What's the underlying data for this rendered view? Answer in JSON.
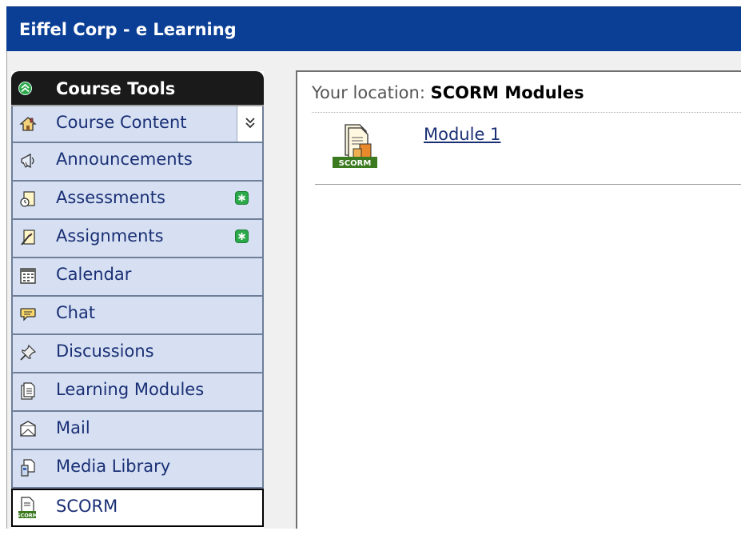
{
  "app": {
    "title": "Eiffel Corp - e Learning"
  },
  "sidebar": {
    "header": "Course Tools",
    "items": [
      {
        "label": "Course Content",
        "icon": "home-icon"
      },
      {
        "label": "Announcements",
        "icon": "megaphone-icon"
      },
      {
        "label": "Assessments",
        "icon": "assessment-icon",
        "badge": "new"
      },
      {
        "label": "Assignments",
        "icon": "assignment-icon",
        "badge": "new"
      },
      {
        "label": "Calendar",
        "icon": "calendar-icon"
      },
      {
        "label": "Chat",
        "icon": "chat-bubble-icon"
      },
      {
        "label": "Discussions",
        "icon": "pushpin-icon"
      },
      {
        "label": "Learning Modules",
        "icon": "document-icon"
      },
      {
        "label": "Mail",
        "icon": "envelope-icon"
      },
      {
        "label": "Media Library",
        "icon": "media-library-icon"
      },
      {
        "label": "SCORM",
        "icon": "scorm-icon",
        "active": true
      }
    ]
  },
  "main": {
    "location_prefix": "Your location:",
    "location_value": "SCORM Modules",
    "modules": [
      {
        "label": "Module 1",
        "icon_text": "SCORM"
      }
    ]
  },
  "colors": {
    "titlebar": "#0b3f96",
    "nav_bg": "#d6e0f2",
    "nav_text": "#1a2f75",
    "badge_green": "#2aa84a"
  }
}
